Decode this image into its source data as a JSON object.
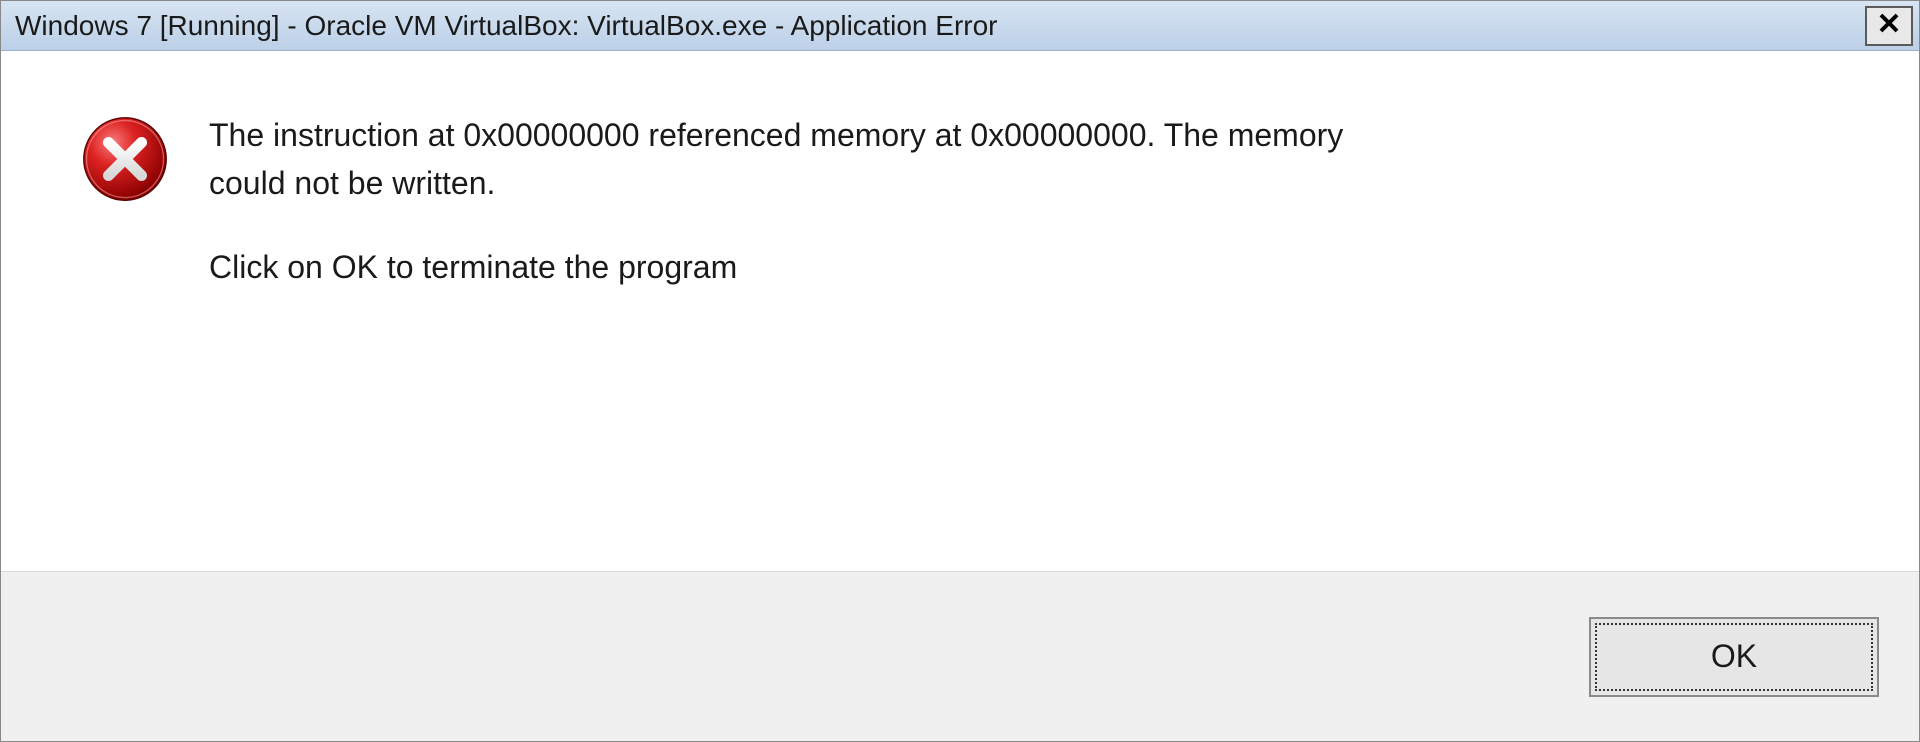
{
  "titlebar": {
    "title": "Windows 7 [Running] - Oracle VM VirtualBox: VirtualBox.exe - Application Error"
  },
  "message": {
    "line1": "The instruction at 0x00000000 referenced memory at 0x00000000. The memory could not be written.",
    "line2": "Click on OK to terminate the program"
  },
  "buttons": {
    "ok_label": "OK"
  }
}
